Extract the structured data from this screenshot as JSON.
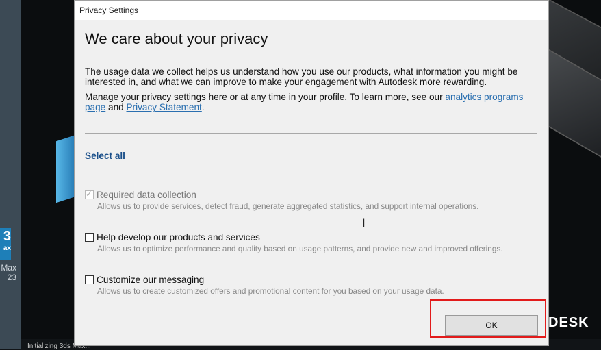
{
  "desktop": {
    "app_icon_text": "3",
    "app_icon_sub": "ax",
    "app_label_line1": "Max",
    "app_label_line2": "23"
  },
  "splash": {
    "brand_text": "DESK",
    "status_text": "Initializing 3ds Max..."
  },
  "dialog": {
    "title": "Privacy Settings",
    "heading": "We care about your privacy",
    "intro": "The usage data we collect helps us understand how you use our products, what information you might be interested in, and what we can improve to make your engagement with Autodesk more rewarding.",
    "manage_prefix": "Manage your privacy settings here or at any time in your profile. To learn more, see our ",
    "analytics_link": "analytics programs page",
    "and_text": " and ",
    "privacy_link": "Privacy Statement",
    "period": ".",
    "select_all": "Select all",
    "options": [
      {
        "label": "Required data collection",
        "description": "Allows us to provide services, detect fraud, generate aggregated statistics, and support internal operations.",
        "checked": true,
        "disabled": true
      },
      {
        "label": "Help develop our products and services",
        "description": "Allows us to optimize performance and quality based on usage patterns, and provide new and improved offerings.",
        "checked": false,
        "disabled": false
      },
      {
        "label": "Customize our messaging",
        "description": "Allows us to create customized offers and promotional content for you based on your usage data.",
        "checked": false,
        "disabled": false
      }
    ],
    "ok_label": "OK"
  },
  "cursor_glyph": "I",
  "colors": {
    "link": "#2a6fb0",
    "highlight": "#e21b1b",
    "dialog_bg": "#f0f0f0"
  }
}
